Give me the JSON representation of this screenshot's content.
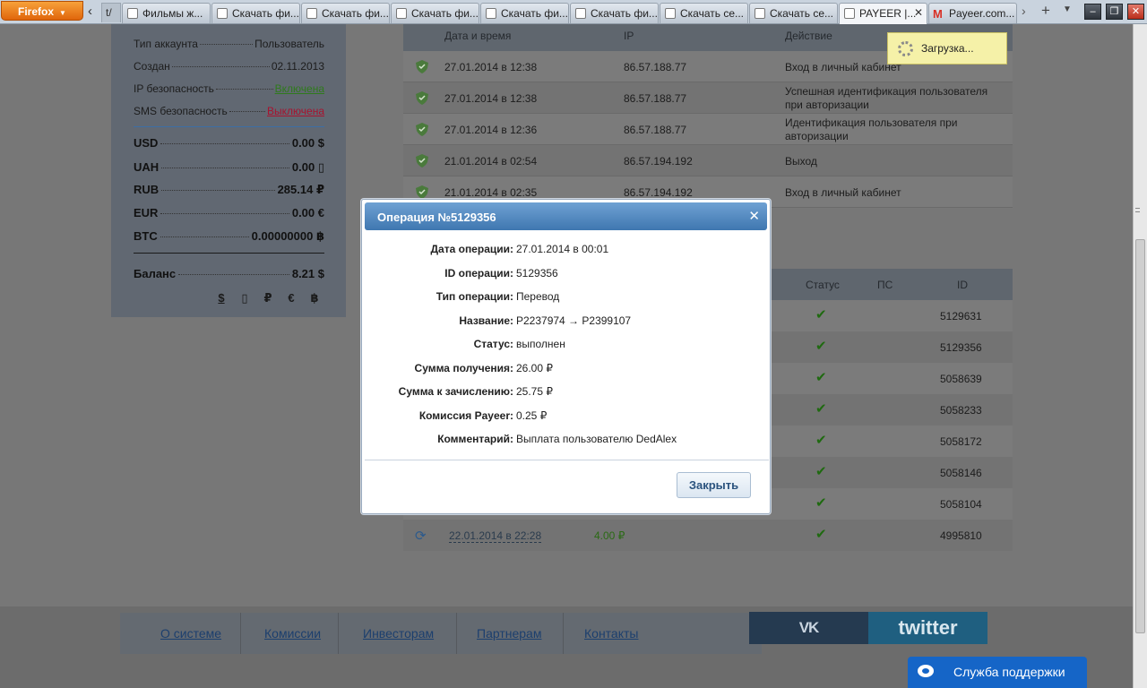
{
  "browser": {
    "menu_label": "Firefox",
    "tab_stub": "t/",
    "tabs": [
      {
        "title": "Фильмы ж..."
      },
      {
        "title": "Скачать фи..."
      },
      {
        "title": "Скачать фи..."
      },
      {
        "title": "Скачать фи..."
      },
      {
        "title": "Скачать фи..."
      },
      {
        "title": "Скачать фи..."
      },
      {
        "title": "Скачать се..."
      },
      {
        "title": "Скачать се..."
      },
      {
        "title": "PAYEER |...",
        "active": true
      },
      {
        "title": "Payeer.com..."
      }
    ]
  },
  "sidebar": {
    "info": [
      {
        "label": "Тип аккаунта",
        "value": "Пользователь"
      },
      {
        "label": "Создан",
        "value": "02.11.2013"
      },
      {
        "label": "IP безопасность",
        "value": "Включена",
        "state": "on"
      },
      {
        "label": "SMS безопасность",
        "value": "Выключена",
        "state": "off"
      }
    ],
    "balances": [
      {
        "currency": "USD",
        "amount": "0.00 $"
      },
      {
        "currency": "UAH",
        "amount": "0.00 ▯"
      },
      {
        "currency": "RUB",
        "amount": "285.14 ₽"
      },
      {
        "currency": "EUR",
        "amount": "0.00 €"
      },
      {
        "currency": "BTC",
        "amount": "0.00000000 ฿"
      }
    ],
    "total_label": "Баланс",
    "total_amount": "8.21 $",
    "currency_switch": [
      "$",
      "▯",
      "₽",
      "€",
      "฿"
    ]
  },
  "history": {
    "headers": {
      "date": "Дата и время",
      "ip": "IP",
      "action": "Действие"
    },
    "rows": [
      {
        "date": "27.01.2014 в 12:38",
        "ip": "86.57.188.77",
        "action": "Вход в личный кабинет"
      },
      {
        "date": "27.01.2014 в 12:38",
        "ip": "86.57.188.77",
        "action": "Успешная идентификация пользователя при авторизации"
      },
      {
        "date": "27.01.2014 в 12:36",
        "ip": "86.57.188.77",
        "action": "Идентификация пользователя при авторизации"
      },
      {
        "date": "21.01.2014 в 02:54",
        "ip": "86.57.194.192",
        "action": "Выход"
      },
      {
        "date": "21.01.2014 в 02:35",
        "ip": "86.57.194.192",
        "action": "Вход в личный кабинет"
      }
    ]
  },
  "loading": {
    "text": "Загрузка..."
  },
  "transactions": {
    "headers": {
      "status": "Статус",
      "ps": "ПС",
      "id": "ID"
    },
    "rows": [
      {
        "id": "5129631"
      },
      {
        "id": "5129356"
      },
      {
        "id": "5058639"
      },
      {
        "id": "5058233"
      },
      {
        "id": "5058172"
      },
      {
        "id": "5058146"
      },
      {
        "id": "5058104"
      },
      {
        "id": "4995810",
        "date": "22.01.2014 в 22:28",
        "amount": "4.00 ₽"
      }
    ]
  },
  "modal": {
    "title": "Операция №5129356",
    "fields": [
      {
        "label": "Дата операции:",
        "value": "27.01.2014 в 00:01"
      },
      {
        "label": "ID операции:",
        "value": "5129356"
      },
      {
        "label": "Тип операции:",
        "value": "Перевод"
      },
      {
        "label": "Название:",
        "value": "P2237974 → P2399107"
      },
      {
        "label": "Статус:",
        "value": "выполнен"
      },
      {
        "label": "Сумма получения:",
        "value": "26.00 ₽"
      },
      {
        "label": "Сумма к зачислению:",
        "value": "25.75 ₽"
      },
      {
        "label": "Комиссия Payeer:",
        "value": "0.25 ₽"
      },
      {
        "label": "Комментарий:",
        "value": "Выплата пользователю DedAlex"
      }
    ],
    "close_label": "Закрыть"
  },
  "footer": {
    "links": [
      "О системе",
      "Комиссии",
      "Инвесторам",
      "Партнерам",
      "Контакты"
    ],
    "vk": "VK",
    "twitter": "twitter",
    "support": "Служба поддержки"
  },
  "colors": {
    "modal_header": "#4f88c2",
    "link": "#1c3f6e",
    "support": "#1565c7"
  }
}
